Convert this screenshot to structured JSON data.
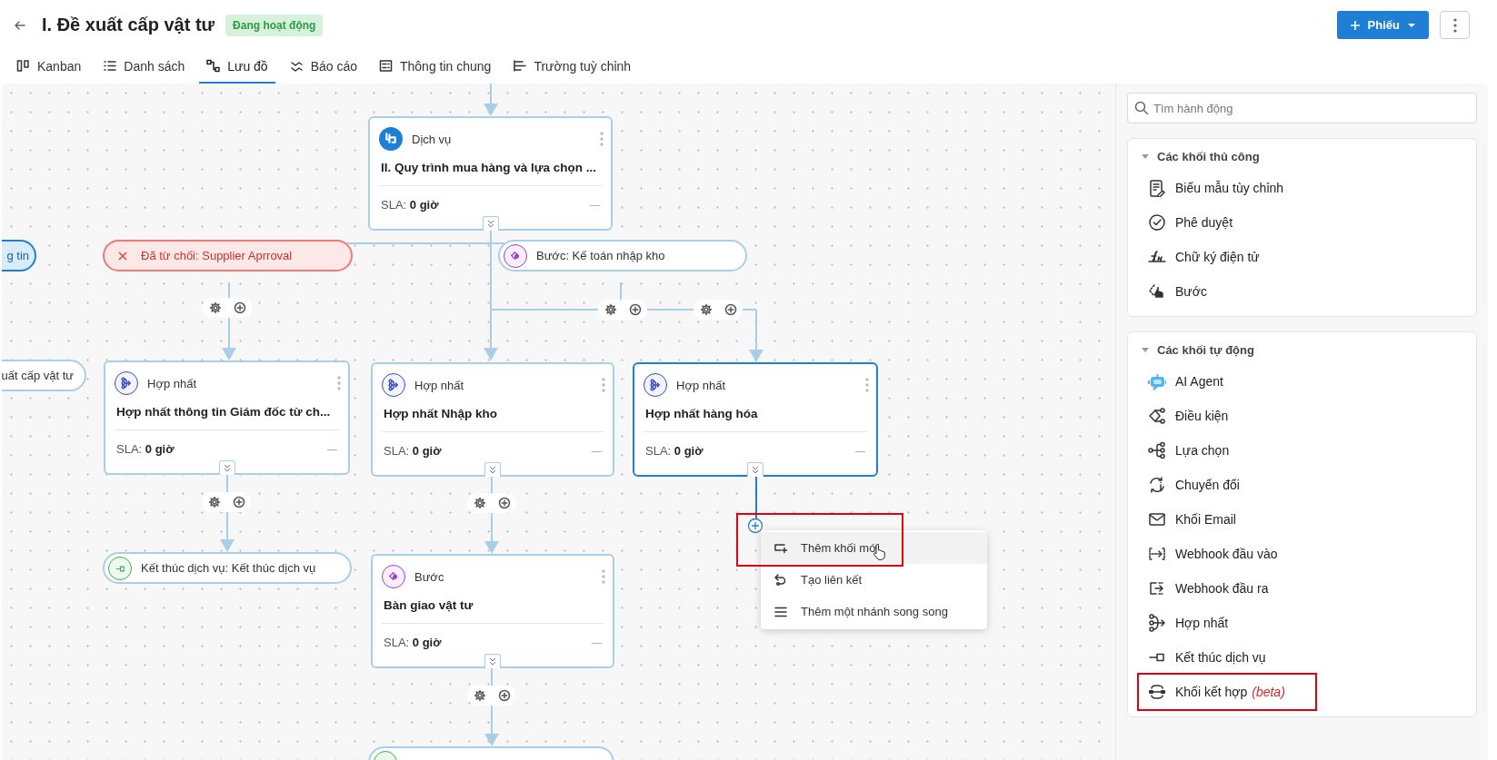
{
  "header": {
    "title": "I. Đề xuất cấp vật tư",
    "status": "Đang hoạt động",
    "primary_button": "Phiếu"
  },
  "tabs": [
    {
      "label": "Kanban",
      "selected": false
    },
    {
      "label": "Danh sách",
      "selected": false
    },
    {
      "label": "Lưu đồ",
      "selected": true
    },
    {
      "label": "Báo cáo",
      "selected": false
    },
    {
      "label": "Thông tin chung",
      "selected": false
    },
    {
      "label": "Trường tuỳ chỉnh",
      "selected": false
    }
  ],
  "flow": {
    "nodes": [
      {
        "kind": "pill",
        "label": "g tin"
      },
      {
        "kind": "card",
        "type_label": "Dịch vụ",
        "title": "II. Quy trình mua hàng và lựa chọn ...",
        "sla_label": "SLA:",
        "sla_value": "0 giờ",
        "dash": "—",
        "selected": false
      },
      {
        "kind": "pill",
        "label": "Đã từ chối: Supplier Aprroval"
      },
      {
        "kind": "pill",
        "label": "Bước: Kế toán nhập kho"
      },
      {
        "kind": "pill",
        "label": "uất cấp vật tư"
      },
      {
        "kind": "card",
        "type_label": "Hợp nhất",
        "title": "Hợp nhất thông tin Giám đốc từ ch...",
        "sla_label": "SLA:",
        "sla_value": "0 giờ",
        "dash": "—",
        "selected": false
      },
      {
        "kind": "card",
        "type_label": "Hợp nhất",
        "title": "Hợp nhất Nhập kho",
        "sla_label": "SLA:",
        "sla_value": "0 giờ",
        "dash": "—",
        "selected": false
      },
      {
        "kind": "card",
        "type_label": "Hợp nhất",
        "title": "Hợp nhất hàng hóa",
        "sla_label": "SLA:",
        "sla_value": "0 giờ",
        "dash": "—",
        "selected": true
      },
      {
        "kind": "pill",
        "label": "Kết thúc dịch vụ: Kết thúc dịch vụ"
      },
      {
        "kind": "card",
        "type_label": "Bước",
        "title": "Bàn giao vật tư",
        "sla_label": "SLA:",
        "sla_value": "0 giờ",
        "dash": "—",
        "selected": false
      },
      {
        "kind": "pill"
      }
    ],
    "menu": {
      "items": [
        {
          "label": "Thêm khối mới",
          "hovered": true,
          "highlighted": true
        },
        {
          "label": "Tạo liên kết",
          "hovered": false,
          "highlighted": false
        },
        {
          "label": "Thêm một nhánh song song",
          "hovered": false,
          "highlighted": false
        }
      ]
    }
  },
  "panel": {
    "search": {
      "placeholder": "Tìm hành động"
    },
    "sections": [
      {
        "title": "Các khối thủ công",
        "expanded": true,
        "items": [
          {
            "label": "Biểu mẫu tùy chỉnh",
            "highlighted": false
          },
          {
            "label": "Phê duyệt",
            "highlighted": false
          },
          {
            "label": "Chữ ký điện tử",
            "highlighted": false
          },
          {
            "label": "Bước",
            "highlighted": false
          }
        ]
      },
      {
        "title": "Các khối tự động",
        "expanded": true,
        "items": [
          {
            "label": "AI Agent",
            "highlighted": false
          },
          {
            "label": "Điều kiện",
            "highlighted": false
          },
          {
            "label": "Lựa chọn",
            "highlighted": false
          },
          {
            "label": "Chuyển đổi",
            "highlighted": false
          },
          {
            "label": "Khối Email",
            "highlighted": false
          },
          {
            "label": "Webhook đầu vào",
            "highlighted": false
          },
          {
            "label": "Webhook đầu ra",
            "highlighted": false
          },
          {
            "label": "Hợp nhất",
            "highlighted": false
          },
          {
            "label": "Kết thúc dịch vụ",
            "highlighted": false
          },
          {
            "label": "Khối kết hợp",
            "tag": "(beta)",
            "highlighted": true
          }
        ]
      }
    ]
  }
}
